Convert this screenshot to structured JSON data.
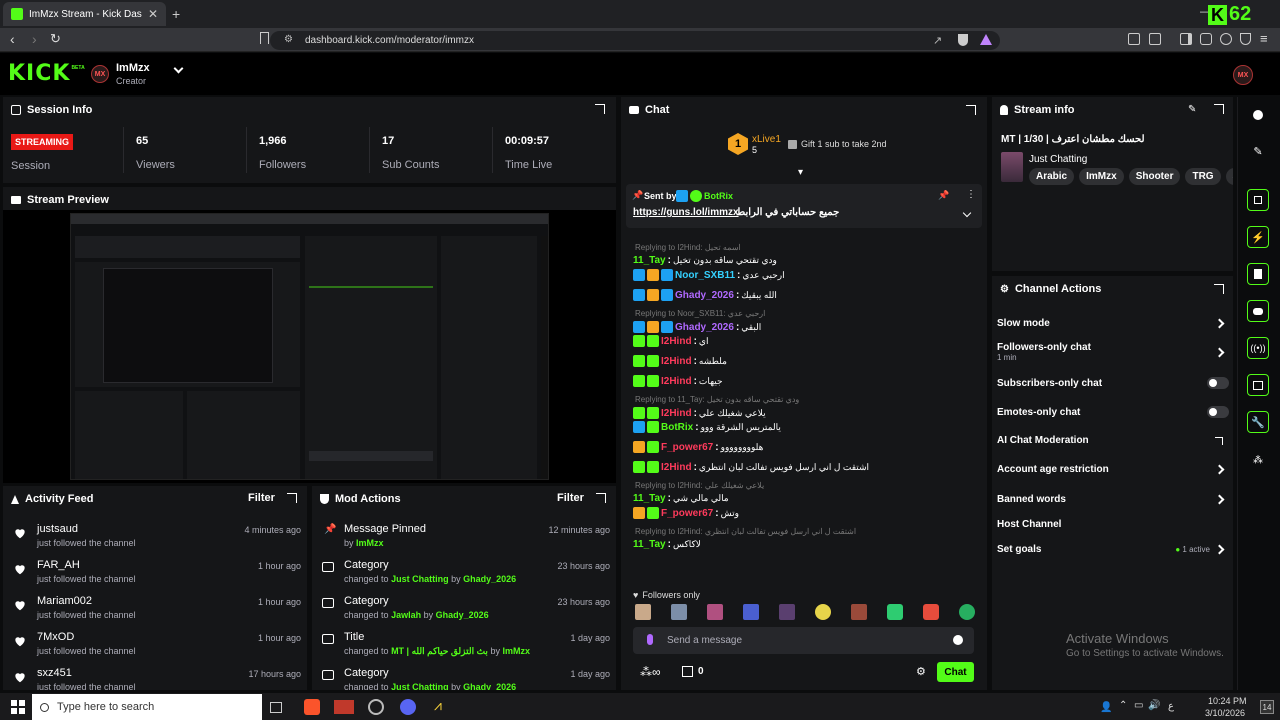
{
  "browser": {
    "tab_title": "ImMzx Stream - Kick Dashboard",
    "url": "dashboard.kick.com/moderator/immzx",
    "corner_badge": "62"
  },
  "app": {
    "logo": "KICK",
    "logo_sup": "BETA",
    "channel_name": "ImMzx",
    "channel_role": "Creator"
  },
  "session": {
    "title": "Session Info",
    "status": "STREAMING",
    "status_label": "Session",
    "stats": [
      {
        "value": "65",
        "label": "Viewers"
      },
      {
        "value": "1,966",
        "label": "Followers"
      },
      {
        "value": "17",
        "label": "Sub Counts"
      },
      {
        "value": "00:09:57",
        "label": "Time Live"
      }
    ]
  },
  "preview": {
    "title": "Stream Preview"
  },
  "activity": {
    "title": "Activity Feed",
    "filter": "Filter",
    "items": [
      {
        "name": "justsaud",
        "sub": "just followed the channel",
        "time": "4 minutes ago"
      },
      {
        "name": "FAR_AH",
        "sub": "just followed the channel",
        "time": "1 hour ago"
      },
      {
        "name": "Mariam002",
        "sub": "just followed the channel",
        "time": "1 hour ago"
      },
      {
        "name": "7MxOD",
        "sub": "just followed the channel",
        "time": "1 hour ago"
      },
      {
        "name": "sxz451",
        "sub": "just followed the channel",
        "time": "17 hours ago"
      }
    ]
  },
  "mod": {
    "title": "Mod Actions",
    "filter": "Filter",
    "items": [
      {
        "title": "Message Pinned",
        "pre": "by",
        "a": "ImMzx",
        "mid": "",
        "b": "",
        "time": "12 minutes ago"
      },
      {
        "title": "Category",
        "pre": "changed to",
        "a": "Just Chatting",
        "mid": "by",
        "b": "Ghady_2026",
        "time": "23 hours ago"
      },
      {
        "title": "Category",
        "pre": "changed to",
        "a": "Jawlah",
        "mid": "by",
        "b": "Ghady_2026",
        "time": "23 hours ago"
      },
      {
        "title": "Title",
        "pre": "changed to",
        "a": "MT | بث التزلق حياكم الله",
        "mid": "by",
        "b": "ImMzx",
        "time": "1 day ago"
      },
      {
        "title": "Category",
        "pre": "changed to",
        "a": "Just Chatting",
        "mid": "by",
        "b": "Ghady_2026",
        "time": "1 day ago"
      }
    ]
  },
  "chat": {
    "title": "Chat",
    "top_user": "xLive1",
    "top_rank": "1",
    "top_count": "5",
    "gift_text": "Gift 1 sub to take 2nd",
    "pinned_by_label": "Sent by",
    "pinned_by": "BotRix",
    "pinned_link": "https://guns.lol/immzx",
    "pinned_text": "جميع حساباتي في الرابط",
    "messages": [
      {
        "reply": "Replying to I2Hind: اسمه تحيل",
        "user": "11_Tay",
        "color": "#53fc18",
        "text": "ودي تقتحي ساقه بدون تخيل",
        "badges": []
      },
      {
        "reply": "",
        "user": "Noor_SXB11",
        "color": "#34d1ff",
        "text": "ارحبي عدي",
        "badges": [
          "b1",
          "b2",
          "b1"
        ]
      },
      {
        "reply": "",
        "user": "Ghady_2026",
        "color": "#b069ff",
        "text": "الله يبقيك",
        "badges": [
          "b1",
          "b2",
          "b1"
        ]
      },
      {
        "reply": "Replying to Noor_SXB11: ارحبي عدي",
        "user": "Ghady_2026",
        "color": "#b069ff",
        "text": "البقي",
        "badges": [
          "b1",
          "b2",
          "b1"
        ]
      },
      {
        "reply": "",
        "user": "I2Hind",
        "color": "#ff3b5c",
        "text": "اي",
        "badges": [
          "b3",
          "b3"
        ]
      },
      {
        "reply": "",
        "user": "I2Hind",
        "color": "#ff3b5c",
        "text": "ملطشه",
        "badges": [
          "b3",
          "b3"
        ]
      },
      {
        "reply": "",
        "user": "I2Hind",
        "color": "#ff3b5c",
        "text": "جيهات",
        "badges": [
          "b3",
          "b3"
        ]
      },
      {
        "reply": "Replying to 11_Tay: ودي تقتحي ساقه بدون تخيل",
        "user": "I2Hind",
        "color": "#ff3b5c",
        "text": "يلاعي شغيلك علي",
        "badges": [
          "b3",
          "b3"
        ]
      },
      {
        "reply": "",
        "user": "BotRix",
        "color": "#53fc18",
        "text": "يالمتريس الشرقة ووو",
        "badges": [
          "b1",
          "b3"
        ]
      },
      {
        "reply": "",
        "user": "F_power67",
        "color": "#ff3b5c",
        "text": "هلوووووووو",
        "badges": [
          "b2",
          "b3"
        ]
      },
      {
        "reply": "",
        "user": "I2Hind",
        "color": "#ff3b5c",
        "text": "اشتقت ل اني ارسل فويس تفالت لبان انتظري",
        "badges": [
          "b3",
          "b3"
        ]
      },
      {
        "reply": "Replying to I2Hind: يلاعي شغيلك علي",
        "user": "11_Tay",
        "color": "#53fc18",
        "text": "مالي مالي شي",
        "badges": []
      },
      {
        "reply": "",
        "user": "F_power67",
        "color": "#ff3b5c",
        "text": "وتش",
        "badges": [
          "b2",
          "b3"
        ]
      },
      {
        "reply": "Replying to I2Hind: اشتقت ل اني ارسل فويس تفالت لبان انتظري",
        "user": "11_Tay",
        "color": "#53fc18",
        "text": "لاكاكس",
        "badges": []
      }
    ],
    "followers_only": "Followers only",
    "input_placeholder": "Send a message",
    "send_label": "Chat",
    "footer_count": "0"
  },
  "stream_info": {
    "title": "Stream info",
    "stream_title": "MT | 1/30 | لحسك مطشان اعترف",
    "category": "Just Chatting",
    "tags": [
      "Arabic",
      "ImMzx",
      "Shooter",
      "TRG",
      "ara"
    ]
  },
  "channel_actions": {
    "title": "Channel Actions",
    "items": [
      {
        "label": "Slow mode",
        "sub": "",
        "control": "chevron"
      },
      {
        "label": "Followers-only chat",
        "sub": "1 min",
        "control": "chevron"
      },
      {
        "label": "Subscribers-only chat",
        "sub": "",
        "control": "toggle"
      },
      {
        "label": "Emotes-only chat",
        "sub": "",
        "control": "toggle"
      },
      {
        "label": "AI Chat Moderation",
        "sub": "",
        "control": "external"
      },
      {
        "label": "Account age restriction",
        "sub": "",
        "control": "chevron"
      },
      {
        "label": "Banned words",
        "sub": "",
        "control": "chevron"
      },
      {
        "label": "Host Channel",
        "sub": "",
        "control": "none"
      },
      {
        "label": "Set goals",
        "sub": "",
        "control": "chevron",
        "badge": "1 active"
      }
    ]
  },
  "watermark": {
    "title": "Activate Windows",
    "sub": "Go to Settings to activate Windows."
  },
  "taskbar": {
    "search_placeholder": "Type here to search",
    "time": "10:24 PM",
    "date": "3/10/2026",
    "lang": "ع",
    "notif": "14"
  },
  "colors": {
    "accent": "#53fc18",
    "panel": "#151618",
    "live": "#e91916"
  }
}
